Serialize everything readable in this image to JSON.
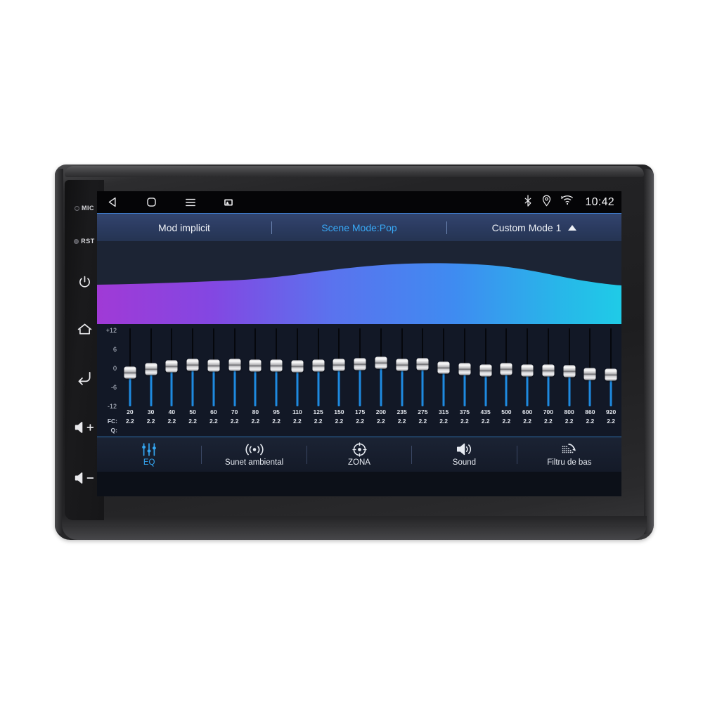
{
  "device": {
    "hardware_buttons": [
      {
        "name": "mic",
        "label": "MIC"
      },
      {
        "name": "reset",
        "label": "RST"
      },
      {
        "name": "power",
        "label": ""
      },
      {
        "name": "home",
        "label": ""
      },
      {
        "name": "back",
        "label": ""
      },
      {
        "name": "volume-up",
        "label": ""
      },
      {
        "name": "volume-down",
        "label": ""
      }
    ]
  },
  "statusbar": {
    "nav": [
      {
        "icon": "back-triangle-icon",
        "label": "Back"
      },
      {
        "icon": "home-square-icon",
        "label": "Home"
      },
      {
        "icon": "menu-icon",
        "label": "Menu"
      },
      {
        "icon": "screenshot-icon",
        "label": "Screenshot"
      }
    ],
    "icons": [
      "bluetooth-icon",
      "location-icon",
      "wifi-icon"
    ],
    "clock": "10:42"
  },
  "modebar": {
    "default_mode": "Mod implicit",
    "scene_mode": "Scene Mode:Pop",
    "custom_mode": "Custom Mode 1",
    "expand_icon": "caret-up-icon",
    "accent": "#38a8f5"
  },
  "curve": {
    "gradient_start": "#9b3fd4",
    "gradient_mid": "#4a7ef0",
    "gradient_end": "#22c5e8",
    "background": "#1c2434"
  },
  "eq": {
    "fc_label": "FC:",
    "q_label": "Q:",
    "db_ticks": [
      "+12",
      "6",
      "0",
      "-6",
      "-12"
    ],
    "db_range": [
      -12,
      12
    ],
    "bands": [
      {
        "fc": "20",
        "q": "2.2",
        "gain": -1.4
      },
      {
        "fc": "30",
        "q": "2.2",
        "gain": -0.3
      },
      {
        "fc": "40",
        "q": "2.2",
        "gain": 0.6
      },
      {
        "fc": "50",
        "q": "2.2",
        "gain": 1.1
      },
      {
        "fc": "60",
        "q": "2.2",
        "gain": 0.9
      },
      {
        "fc": "70",
        "q": "2.2",
        "gain": 1.1
      },
      {
        "fc": "80",
        "q": "2.2",
        "gain": 0.9
      },
      {
        "fc": "95",
        "q": "2.2",
        "gain": 0.9
      },
      {
        "fc": "110",
        "q": "2.2",
        "gain": 0.6
      },
      {
        "fc": "125",
        "q": "2.2",
        "gain": 0.8
      },
      {
        "fc": "150",
        "q": "2.2",
        "gain": 1.1
      },
      {
        "fc": "175",
        "q": "2.2",
        "gain": 1.3
      },
      {
        "fc": "200",
        "q": "2.2",
        "gain": 1.7
      },
      {
        "fc": "235",
        "q": "2.2",
        "gain": 1.1
      },
      {
        "fc": "275",
        "q": "2.2",
        "gain": 1.4
      },
      {
        "fc": "315",
        "q": "2.2",
        "gain": 0.3
      },
      {
        "fc": "375",
        "q": "2.2",
        "gain": -0.2
      },
      {
        "fc": "435",
        "q": "2.2",
        "gain": -0.6
      },
      {
        "fc": "500",
        "q": "2.2",
        "gain": -0.3
      },
      {
        "fc": "600",
        "q": "2.2",
        "gain": -0.7
      },
      {
        "fc": "700",
        "q": "2.2",
        "gain": -0.6
      },
      {
        "fc": "800",
        "q": "2.2",
        "gain": -0.8
      },
      {
        "fc": "860",
        "q": "2.2",
        "gain": -1.7
      },
      {
        "fc": "920",
        "q": "2.2",
        "gain": -2.1
      }
    ]
  },
  "tabs": [
    {
      "label": "EQ",
      "icon": "equalizer-icon",
      "active": true
    },
    {
      "label": "Sunet ambiental",
      "icon": "surround-sound-icon",
      "active": false
    },
    {
      "label": "ZONA",
      "icon": "zone-target-icon",
      "active": false
    },
    {
      "label": "Sound",
      "icon": "speaker-icon",
      "active": false
    },
    {
      "label": "Filtru de bas",
      "icon": "bass-filter-icon",
      "active": false
    }
  ]
}
